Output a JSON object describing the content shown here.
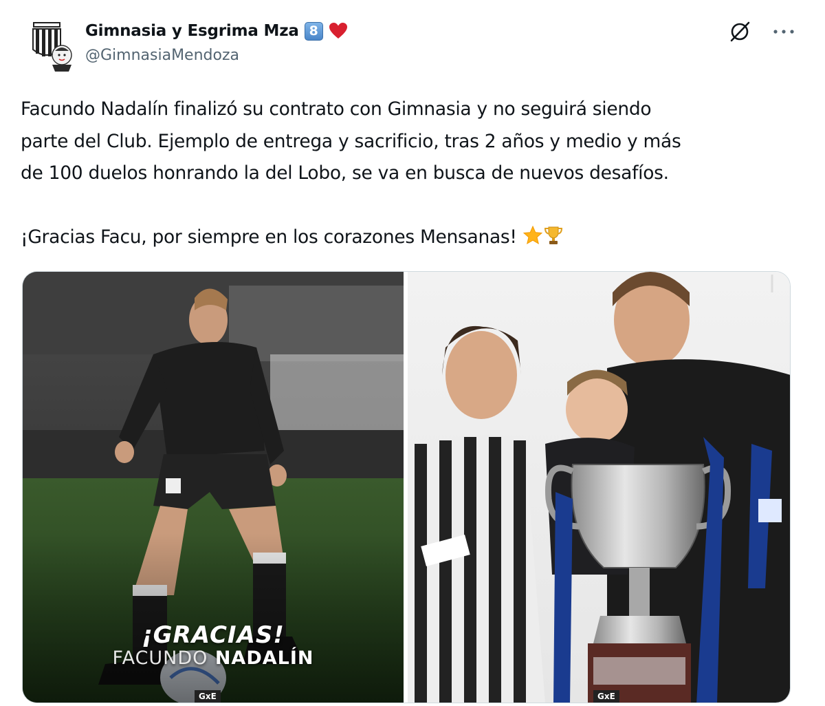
{
  "account": {
    "display_name": "Gimnasia y Esgrima Mza",
    "badge_number": "8",
    "handle": "@GimnasiaMendoza"
  },
  "tweet": {
    "paragraph_1_line_1": "Facundo Nadalín finalizó su contrato con Gimnasia y no seguirá siendo",
    "paragraph_1_line_2": "parte del Club. Ejemplo de entrega y sacrificio, tras 2 años y medio y más",
    "paragraph_1_line_3": "de 100 duelos honrando la del Lobo, se va en busca de nuevos desafíos.",
    "paragraph_2": "¡Gracias Facu, por siempre en los corazones Mensanas!"
  },
  "media": {
    "left_overlay_title": "¡GRACIAS!",
    "left_overlay_first_name": "FACUNDO",
    "left_overlay_last_name": "NADALÍN",
    "left_tag": "GxE",
    "right_tag": "GxE"
  },
  "icons": {
    "badge": "keycap-8-icon",
    "heart": "red-heart-icon",
    "grok": "grok-icon",
    "more": "more-icon",
    "star": "star-emoji-icon",
    "trophy": "trophy-emoji-icon"
  },
  "colors": {
    "text_primary": "#0f1419",
    "text_secondary": "#536471",
    "heart": "#d8202f",
    "badge": "#4a86c9"
  }
}
